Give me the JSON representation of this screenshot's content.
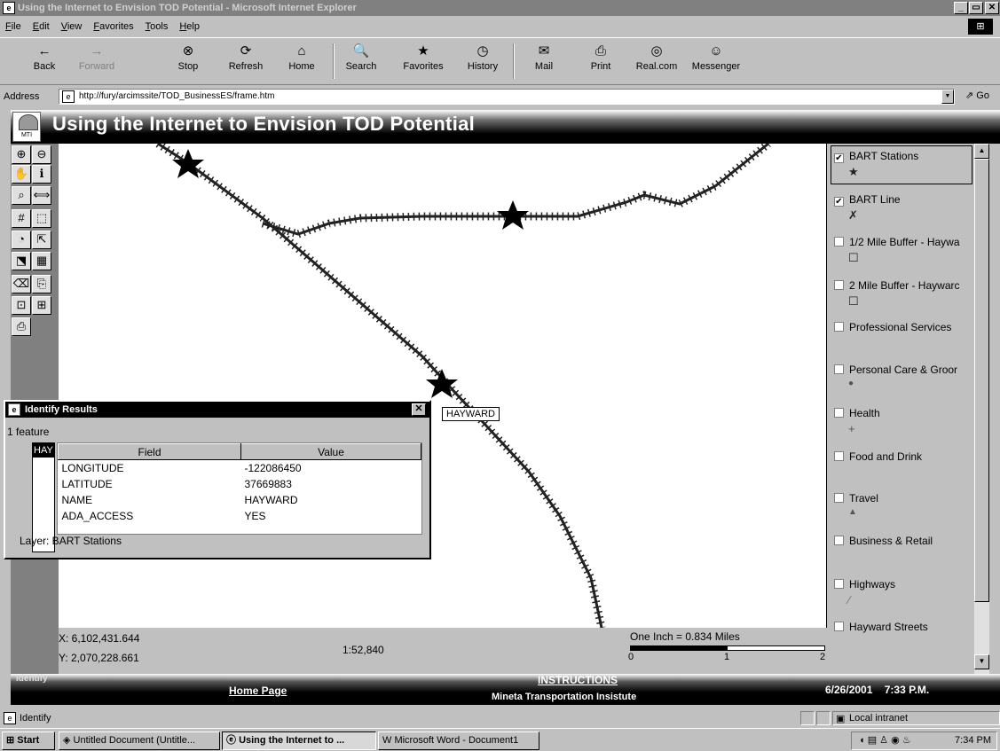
{
  "window": {
    "title": "Using the Internet to Envision TOD Potential - Microsoft Internet Explorer",
    "buttons": [
      "_",
      "▭",
      "✕"
    ]
  },
  "menu": [
    "File",
    "Edit",
    "View",
    "Favorites",
    "Tools",
    "Help"
  ],
  "toolbar": [
    {
      "label": "Back",
      "icon": "←",
      "enabled": true
    },
    {
      "label": "Forward",
      "icon": "→",
      "enabled": false
    },
    {
      "label": "Stop",
      "icon": "⊗",
      "enabled": true
    },
    {
      "label": "Refresh",
      "icon": "⟳",
      "enabled": true
    },
    {
      "label": "Home",
      "icon": "⌂",
      "enabled": true
    },
    {
      "label": "Search",
      "icon": "🔍",
      "enabled": true
    },
    {
      "label": "Favorites",
      "icon": "★",
      "enabled": true
    },
    {
      "label": "History",
      "icon": "◷",
      "enabled": true
    },
    {
      "label": "Mail",
      "icon": "✉",
      "enabled": true
    },
    {
      "label": "Print",
      "icon": "⎙",
      "enabled": true
    },
    {
      "label": "Real.com",
      "icon": "◎",
      "enabled": true
    },
    {
      "label": "Messenger",
      "icon": "☺",
      "enabled": true
    }
  ],
  "address": {
    "label": "Address",
    "url": "http://fury/arcimssite/TOD_BusinessES/frame.htm",
    "go": "Go"
  },
  "app": {
    "title": "Using the Internet to Envision TOD Potential",
    "logo_text": "MTI",
    "active_tool": "Identify"
  },
  "tools": [
    "zoom-in-icon",
    "zoom-out-icon",
    "pan-icon",
    "info-icon",
    "find-icon",
    "measure-icon",
    "grid-icon",
    "select-rect-icon",
    "select-point-icon",
    "select-line-icon",
    "select-poly-icon",
    "table-icon",
    "clear-icon",
    "buffer-icon",
    "query-icon",
    "overview-icon",
    "print-icon"
  ],
  "map": {
    "station_label": "HAYWARD",
    "coords": {
      "x": "X: 6,102,431.644",
      "y": "Y: 2,070,228.661"
    },
    "scale": "1:52,840",
    "scalebar": {
      "text": "One Inch = 0.834 Miles",
      "ticks": [
        "0",
        "1",
        "2"
      ]
    }
  },
  "identify": {
    "title": "Identify Results",
    "count": "1 feature",
    "list_item": "HAY",
    "headers": [
      "Field",
      "Value"
    ],
    "rows": [
      [
        "LONGITUDE",
        "-122086450"
      ],
      [
        "LATITUDE",
        "37669883"
      ],
      [
        "NAME",
        "HAYWARD"
      ],
      [
        "ADA_ACCESS",
        "YES"
      ]
    ],
    "layer": "Layer: BART Stations"
  },
  "legend": [
    {
      "label": "BART Stations",
      "checked": true,
      "symbol": "★"
    },
    {
      "label": "BART Line",
      "checked": true,
      "symbol": "✗"
    },
    {
      "label": "1/2 Mile Buffer - Haywa",
      "checked": false,
      "symbol": "☐"
    },
    {
      "label": "2 Mile Buffer - Haywarc",
      "checked": false,
      "symbol": "☐"
    },
    {
      "label": "Professional Services",
      "checked": false,
      "symbol": ""
    },
    {
      "label": "Personal Care & Groor",
      "checked": false,
      "symbol": "●"
    },
    {
      "label": "Health",
      "checked": false,
      "symbol": "+"
    },
    {
      "label": "Food and Drink",
      "checked": false,
      "symbol": ""
    },
    {
      "label": "Travel",
      "checked": false,
      "symbol": "▲"
    },
    {
      "label": "Business & Retail",
      "checked": false,
      "symbol": ""
    },
    {
      "label": "Highways",
      "checked": false,
      "symbol": "⁄"
    },
    {
      "label": "Hayward Streets",
      "checked": false,
      "symbol": ""
    }
  ],
  "footer": {
    "home": "Home Page",
    "instructions": "INSTRUCTIONS",
    "org": "Mineta Transportation Insistute",
    "datetime": "6/26/2001    7:33 P.M."
  },
  "status": {
    "text": "Identify",
    "zone": "Local intranet"
  },
  "taskbar": {
    "start": "Start",
    "tasks": [
      "Untitled Document (Untitle...",
      "Using the Internet to ...",
      "Microsoft Word - Document1"
    ],
    "clock": "7:34 PM"
  }
}
